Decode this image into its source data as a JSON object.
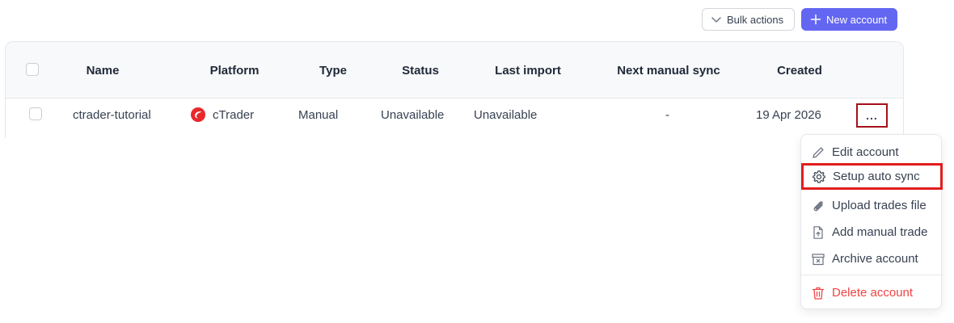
{
  "toolbar": {
    "bulk_actions_label": "Bulk actions",
    "new_account_label": "New account",
    "accent_color": "#6366f1"
  },
  "table": {
    "columns": [
      "Name",
      "Platform",
      "Type",
      "Status",
      "Last import",
      "Next manual sync",
      "Created"
    ],
    "rows": [
      {
        "name": "ctrader-tutorial",
        "platform": "cTrader",
        "platform_icon": "ctrader-logo-icon",
        "type": "Manual",
        "status": "Unavailable",
        "last_import": "Unavailable",
        "next_manual_sync": "-",
        "created": "19 Apr 2026",
        "actions_label": "..."
      }
    ]
  },
  "menu": {
    "items": [
      {
        "label": "Edit account",
        "icon": "pencil-icon"
      },
      {
        "label": "Setup auto sync",
        "icon": "gear-icon",
        "highlighted": true
      },
      {
        "label": "Upload trades file",
        "icon": "paperclip-icon"
      },
      {
        "label": "Add manual trade",
        "icon": "file-plus-icon"
      },
      {
        "label": "Archive account",
        "icon": "archive-icon"
      },
      {
        "label": "Delete account",
        "icon": "trash-icon",
        "danger": true
      }
    ],
    "danger_color": "#ef4444"
  }
}
